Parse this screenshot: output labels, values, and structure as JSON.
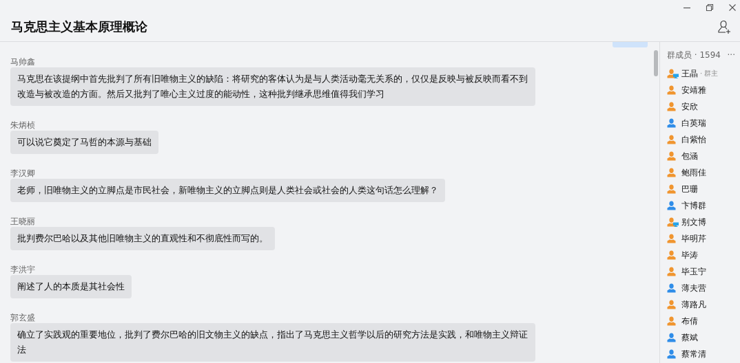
{
  "window": {
    "title": "马克思主义基本原理概论"
  },
  "messages": [
    {
      "sender": "马帅鑫",
      "text": "马克思在该提纲中首先批判了所有旧唯物主义的缺陷：将研究的客体认为是与人类活动毫无关系的，仅仅是反映与被反映而看不到改造与被改造的方面。然后又批判了唯心主义过度的能动性，这种批判继承思维值得我们学习"
    },
    {
      "sender": "朱炳桢",
      "text": "可以说它奠定了马哲的本源与基础"
    },
    {
      "sender": "李汉卿",
      "text": "老师，旧唯物主义的立脚点是市民社会，新唯物主义的立脚点则是人类社会或社会的人类这句话怎么理解？"
    },
    {
      "sender": "王晓丽",
      "text": "批判费尔巴哈以及其他旧唯物主义的直观性和不彻底性而写的。"
    },
    {
      "sender": "李洪宇",
      "text": "阐述了人的本质是其社会性"
    },
    {
      "sender": "郭玄盛",
      "text": "确立了实践观的重要地位，批判了费尔巴哈的旧文物主义的缺点，指出了马克思主义哲学以后的研究方法是实践，和唯物主义辩证法"
    }
  ],
  "members_panel": {
    "title": "群成员 · 1594",
    "more": "···",
    "members": [
      {
        "name": "王晶",
        "role": "· 群主",
        "color": "#f0952f",
        "pc_online": true
      },
      {
        "name": "安靖雅",
        "color": "#f0952f",
        "pc_online": false
      },
      {
        "name": "安欣",
        "color": "#f0952f",
        "pc_online": false
      },
      {
        "name": "白英瑞",
        "color": "#2f8de8",
        "pc_online": false
      },
      {
        "name": "白紫怡",
        "color": "#f0952f",
        "pc_online": false
      },
      {
        "name": "包涵",
        "color": "#f0952f",
        "pc_online": false
      },
      {
        "name": "鲍雨佳",
        "color": "#f0952f",
        "pc_online": false
      },
      {
        "name": "巴珊",
        "color": "#f0952f",
        "pc_online": false
      },
      {
        "name": "卞博群",
        "color": "#2f8de8",
        "pc_online": false
      },
      {
        "name": "别文博",
        "color": "#f0952f",
        "pc_online": true
      },
      {
        "name": "毕明芹",
        "color": "#f0952f",
        "pc_online": false
      },
      {
        "name": "毕涛",
        "color": "#f0952f",
        "pc_online": false
      },
      {
        "name": "毕玉宁",
        "color": "#f0952f",
        "pc_online": false
      },
      {
        "name": "薄夫营",
        "color": "#2f8de8",
        "pc_online": false
      },
      {
        "name": "薄路凡",
        "color": "#f0952f",
        "pc_online": false
      },
      {
        "name": "布倩",
        "color": "#f0952f",
        "pc_online": false
      },
      {
        "name": "蔡斌",
        "color": "#2f8de8",
        "pc_online": false
      },
      {
        "name": "蔡常清",
        "color": "#2f8de8",
        "pc_online": false
      }
    ]
  }
}
